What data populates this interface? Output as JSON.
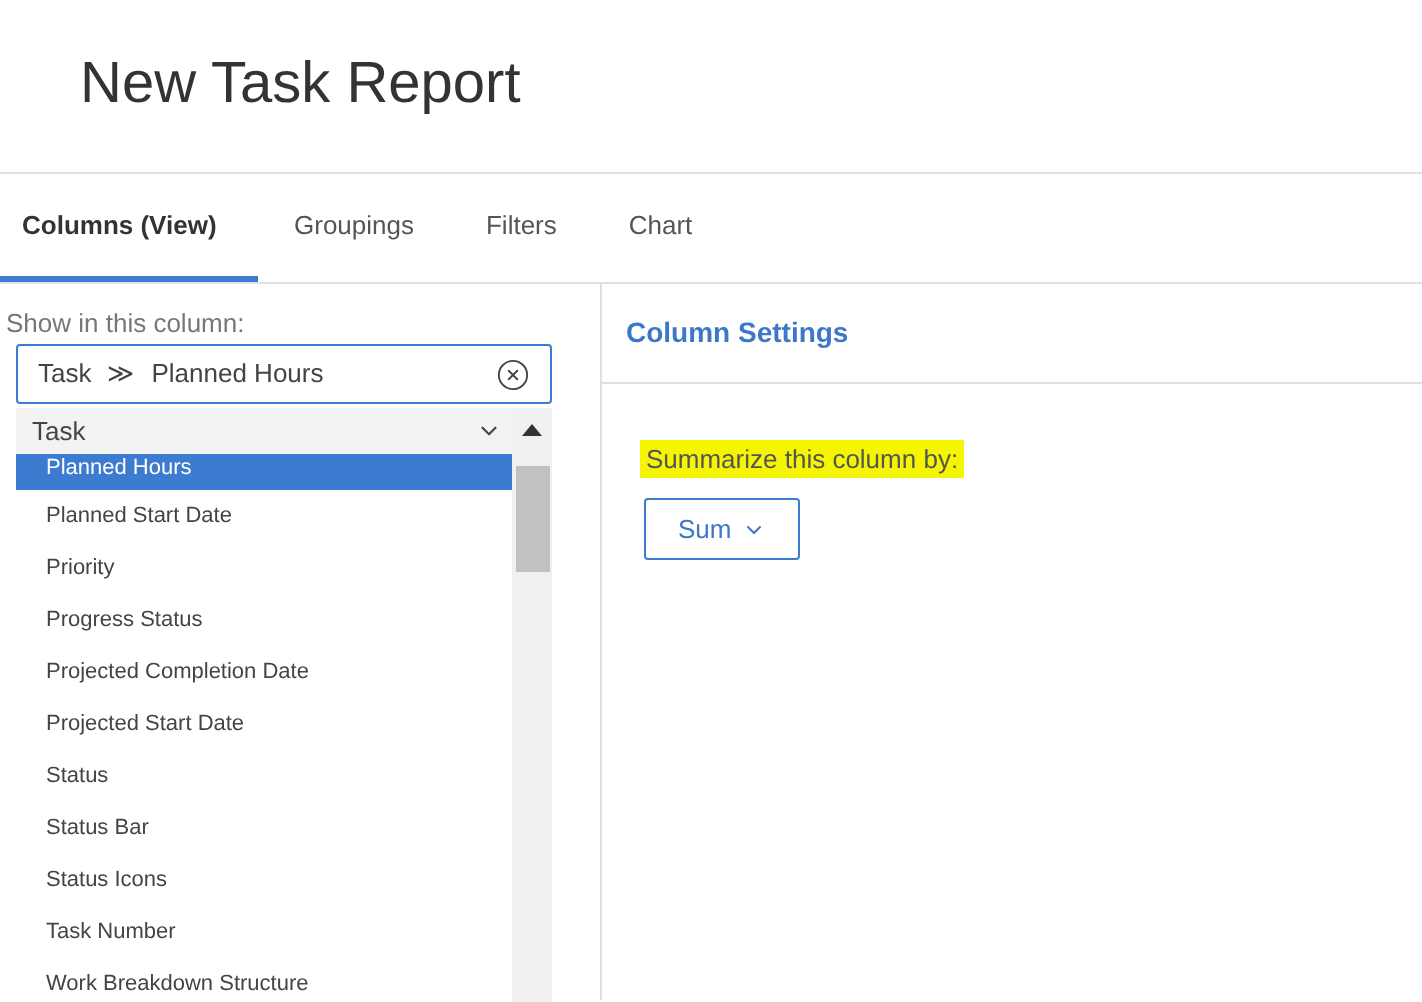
{
  "title": "New Task Report",
  "tabs": [
    {
      "label": "Columns (View)",
      "selected": true
    },
    {
      "label": "Groupings",
      "selected": false
    },
    {
      "label": "Filters",
      "selected": false
    },
    {
      "label": "Chart",
      "selected": false
    }
  ],
  "left_panel": {
    "label": "Show in this column:",
    "field": {
      "object": "Task",
      "separator": "≫",
      "value": "Planned Hours"
    },
    "dropdown": {
      "group": "Task",
      "items": [
        {
          "label": "Planned Hours",
          "selected": true
        },
        {
          "label": "Planned Start Date",
          "selected": false
        },
        {
          "label": "Priority",
          "selected": false
        },
        {
          "label": "Progress Status",
          "selected": false
        },
        {
          "label": "Projected Completion Date",
          "selected": false
        },
        {
          "label": "Projected Start Date",
          "selected": false
        },
        {
          "label": "Status",
          "selected": false
        },
        {
          "label": "Status Bar",
          "selected": false
        },
        {
          "label": "Status Icons",
          "selected": false
        },
        {
          "label": "Task Number",
          "selected": false
        },
        {
          "label": "Work Breakdown Structure",
          "selected": false
        }
      ]
    }
  },
  "right_panel": {
    "title": "Column Settings",
    "summarize_label": "Summarize this column by:",
    "summarize_value": "Sum"
  }
}
